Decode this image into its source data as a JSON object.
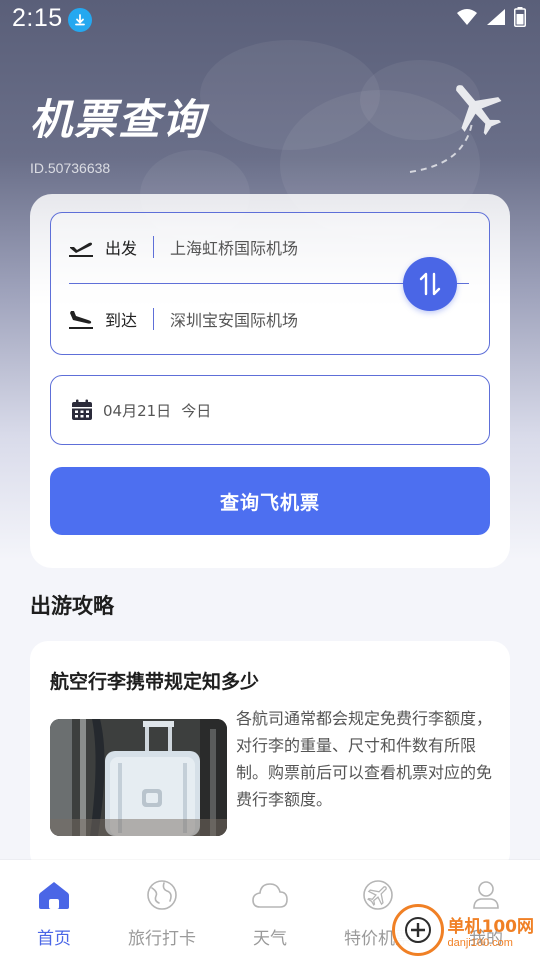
{
  "status_bar": {
    "time": "2:15"
  },
  "header": {
    "title": "机票查询",
    "app_id": "ID.50736638"
  },
  "search": {
    "departure_label": "出发",
    "departure_value": "上海虹桥国际机场",
    "arrival_label": "到达",
    "arrival_value": "深圳宝安国际机场",
    "date": "04月21日",
    "date_tag": "今日",
    "search_button": "查询飞机票"
  },
  "guide": {
    "section_title": "出游攻略",
    "article": {
      "title": "航空行李携带规定知多少",
      "body": "各航司通常都会规定免费行李额度，对行李的重量、尺寸和件数有所限制。购票前后可以查看机票对应的免费行李额度。"
    }
  },
  "bottom_nav": {
    "items": [
      {
        "label": "首页",
        "icon": "home-icon",
        "active": true
      },
      {
        "label": "旅行打卡",
        "icon": "map-pin-icon",
        "active": false
      },
      {
        "label": "天气",
        "icon": "cloud-icon",
        "active": false
      },
      {
        "label": "特价机票",
        "icon": "plane-icon",
        "active": false
      },
      {
        "label": "我的",
        "icon": "user-icon",
        "active": false
      }
    ]
  },
  "watermark": {
    "main": "单机100网",
    "sub": "danji100.com"
  },
  "colors": {
    "accent": "#4d6ff0",
    "border": "#5e6fd8",
    "nav_active": "#4a66e6",
    "nav_inactive": "#9a9a9a",
    "watermark": "#f07a1a"
  }
}
